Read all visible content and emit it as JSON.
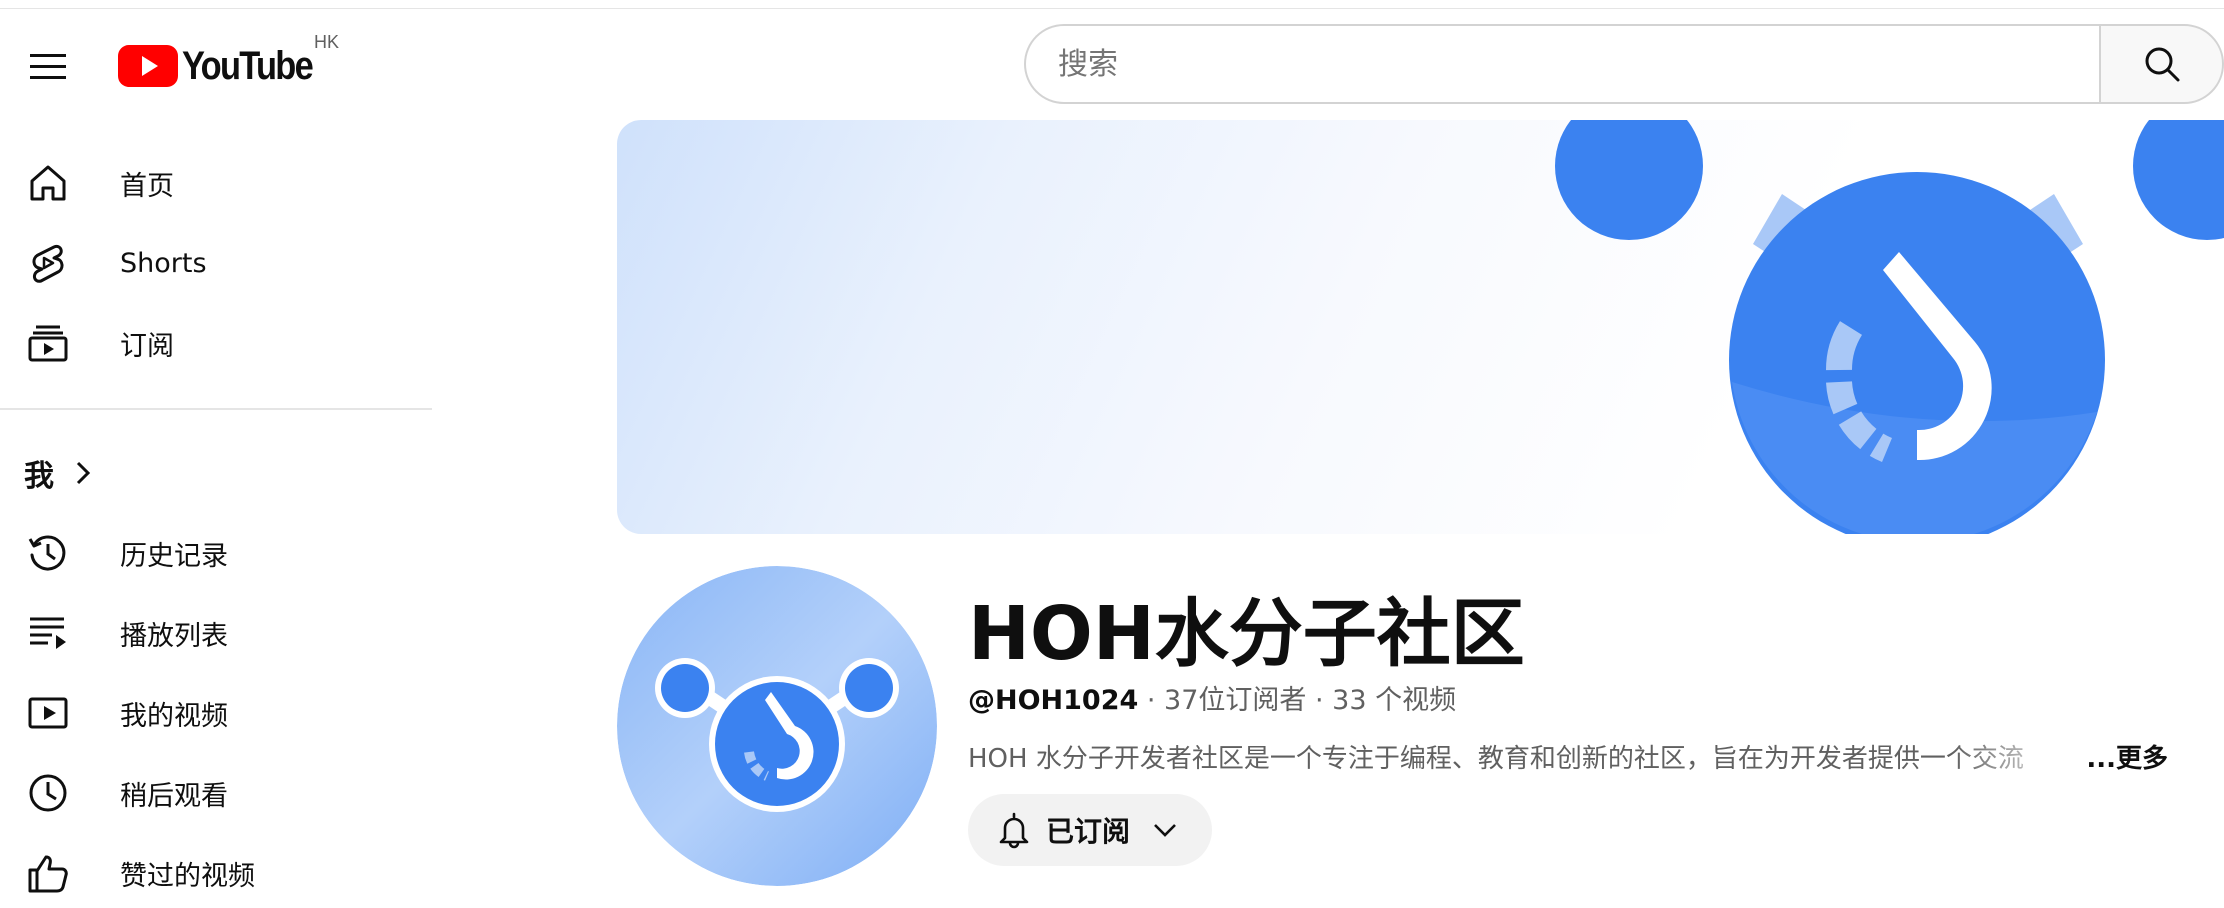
{
  "header": {
    "logo_text": "YouTube",
    "region": "HK",
    "search_placeholder": "搜索"
  },
  "sidebar": {
    "top_items": [
      {
        "label": "首页",
        "icon": "home-icon"
      },
      {
        "label": "Shorts",
        "icon": "shorts-icon"
      },
      {
        "label": "订阅",
        "icon": "subscriptions-icon"
      }
    ],
    "me_label": "我",
    "me_items": [
      {
        "label": "历史记录",
        "icon": "history-icon"
      },
      {
        "label": "播放列表",
        "icon": "playlist-icon"
      },
      {
        "label": "我的视频",
        "icon": "my-videos-icon"
      },
      {
        "label": "稍后观看",
        "icon": "watch-later-icon"
      },
      {
        "label": "赞过的视频",
        "icon": "liked-videos-icon"
      }
    ]
  },
  "channel": {
    "name": "HOH水分子社区",
    "handle": "@HOH1024",
    "subscribers": "37位订阅者",
    "videos": "33 个视频",
    "separator": " · ",
    "description": "HOH 水分子开发者社区是一个专注于编程、教育和创新的社区，旨在为开发者提供一个交流",
    "more_label": "...更多",
    "subscribe_label": "已订阅"
  },
  "colors": {
    "brand_red": "#ff0000",
    "accent_blue": "#3b82f0",
    "light_blue": "#a9c8f7",
    "text_primary": "#0f0f0f",
    "text_secondary": "#606060"
  }
}
